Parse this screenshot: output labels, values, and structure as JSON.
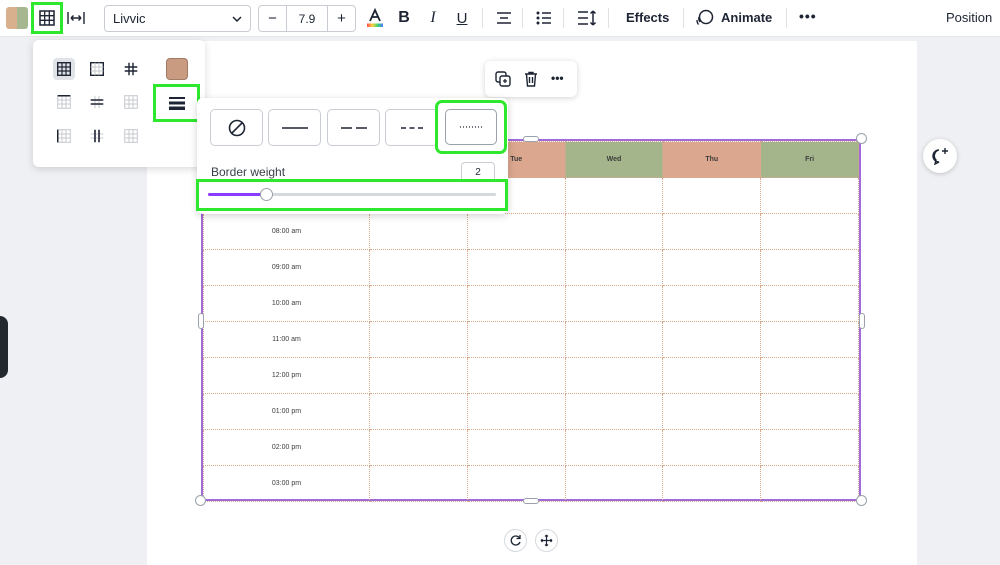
{
  "toolbar": {
    "font": "Livvic",
    "font_size": "7.9",
    "decrease": "−",
    "increase": "+",
    "bold": "B",
    "italic": "I",
    "underline": "U",
    "effects": "Effects",
    "animate": "Animate",
    "position": "Position",
    "more": "•••"
  },
  "table": {
    "header_days": [
      "Tue",
      "Wed",
      "Thu",
      "Fri"
    ],
    "times": [
      "08:00 am",
      "09:00 am",
      "10:00 am",
      "11:00 am",
      "12:00 pm",
      "01:00 pm",
      "02:00 pm",
      "03:00 pm"
    ],
    "colors": {
      "tue": "#dba78f",
      "wed": "#a4b58c",
      "thu": "#dba78f",
      "fri": "#a4b58c",
      "border": "#a06ad8"
    }
  },
  "border_popup": {
    "label": "Border weight",
    "weight": "2",
    "weight_fraction": 0.2,
    "selected_style": "dotted",
    "swatch_color": "#c99c82"
  },
  "context_menu": {
    "more": "•••"
  },
  "highlight_color": "#2ee82e"
}
